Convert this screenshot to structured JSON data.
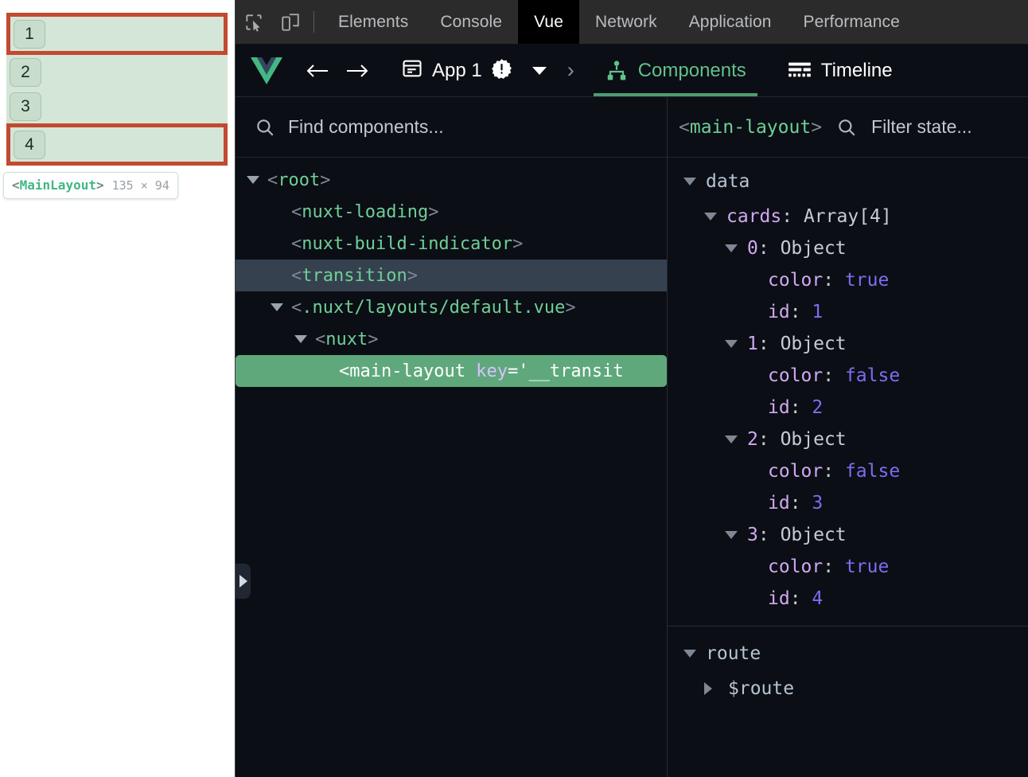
{
  "page_preview": {
    "cards": [
      {
        "number": "1",
        "flagged": true
      },
      {
        "number": "2",
        "flagged": false
      },
      {
        "number": "3",
        "flagged": false
      },
      {
        "number": "4",
        "flagged": true
      }
    ],
    "highlight_tooltip": {
      "open_bracket": "<",
      "component": "MainLayout",
      "close_bracket": ">",
      "dimensions": "135 × 94"
    },
    "colors": {
      "card_background": "#d4e6d7",
      "card_badge": "#c9ddcd",
      "flag_border": "#c24a30",
      "tooltip_tag": "#42b883"
    }
  },
  "devtools": {
    "toolbar_icons": {
      "inspect": "inspect-element-icon",
      "device": "device-toolbar-icon"
    },
    "tabs": [
      {
        "label": "Elements",
        "active": false
      },
      {
        "label": "Console",
        "active": false
      },
      {
        "label": "Vue",
        "active": true
      },
      {
        "label": "Network",
        "active": false
      },
      {
        "label": "Application",
        "active": false
      },
      {
        "label": "Performance",
        "active": false
      }
    ]
  },
  "vue_toolbar": {
    "logo": "vue-logo-icon",
    "back": "back-arrow-icon",
    "forward": "forward-arrow-icon",
    "app_panel_icon": "app-panel-icon",
    "app_label": "App 1",
    "warning_badge": "warning-badge-icon",
    "dropdown_caret": "chevron-down-icon",
    "overflow_chevron": "›",
    "panes": [
      {
        "label": "Components",
        "icon": "components-tree-icon",
        "active": true
      },
      {
        "label": "Timeline",
        "icon": "timeline-icon",
        "active": false
      }
    ]
  },
  "tree_panel": {
    "search": {
      "placeholder": "Find components...",
      "value": "",
      "icon": "search-icon"
    },
    "nodes": [
      {
        "indent": 0,
        "arrow": "down",
        "name": "root",
        "state": "normal"
      },
      {
        "indent": 1,
        "arrow": "none",
        "name": "nuxt-loading",
        "state": "normal"
      },
      {
        "indent": 1,
        "arrow": "none",
        "name": "nuxt-build-indicator",
        "state": "normal"
      },
      {
        "indent": 1,
        "arrow": "none",
        "name": "transition",
        "state": "hovered"
      },
      {
        "indent": 1,
        "arrow": "down",
        "name": ".nuxt/layouts/default.vue",
        "state": "normal"
      },
      {
        "indent": 2,
        "arrow": "down",
        "name": "nuxt",
        "state": "normal"
      },
      {
        "indent": 3,
        "arrow": "none",
        "name": "main-layout",
        "state": "selected",
        "attr_name": "key",
        "attr_value": "='__transit"
      }
    ],
    "collapse_toggle": "expand-panel-icon"
  },
  "state_panel": {
    "header": {
      "open_bracket": "<",
      "component": "main-layout",
      "close_bracket": ">",
      "filter_placeholder": "Filter state...",
      "filter_value": "",
      "search_icon": "search-icon"
    },
    "sections": [
      {
        "name": "data",
        "expanded": true,
        "rows": [
          {
            "indent": 1,
            "arrow": "down",
            "key": "cards",
            "value": "Array[4]",
            "value_kind": "type"
          },
          {
            "indent": 2,
            "arrow": "down",
            "key": "0",
            "value": "Object",
            "value_kind": "type"
          },
          {
            "indent": 3,
            "arrow": "none",
            "key": "color",
            "value": "true",
            "value_kind": "bool"
          },
          {
            "indent": 3,
            "arrow": "none",
            "key": "id",
            "value": "1",
            "value_kind": "num"
          },
          {
            "indent": 2,
            "arrow": "down",
            "key": "1",
            "value": "Object",
            "value_kind": "type"
          },
          {
            "indent": 3,
            "arrow": "none",
            "key": "color",
            "value": "false",
            "value_kind": "bool"
          },
          {
            "indent": 3,
            "arrow": "none",
            "key": "id",
            "value": "2",
            "value_kind": "num"
          },
          {
            "indent": 2,
            "arrow": "down",
            "key": "2",
            "value": "Object",
            "value_kind": "type"
          },
          {
            "indent": 3,
            "arrow": "none",
            "key": "color",
            "value": "false",
            "value_kind": "bool"
          },
          {
            "indent": 3,
            "arrow": "none",
            "key": "id",
            "value": "3",
            "value_kind": "num"
          },
          {
            "indent": 2,
            "arrow": "down",
            "key": "3",
            "value": "Object",
            "value_kind": "type"
          },
          {
            "indent": 3,
            "arrow": "none",
            "key": "color",
            "value": "true",
            "value_kind": "bool"
          },
          {
            "indent": 3,
            "arrow": "none",
            "key": "id",
            "value": "4",
            "value_kind": "num"
          }
        ]
      },
      {
        "name": "route",
        "expanded": true,
        "rows": [
          {
            "indent": 1,
            "arrow": "right",
            "key": "$route",
            "value": "",
            "value_kind": "section"
          }
        ]
      }
    ]
  }
}
